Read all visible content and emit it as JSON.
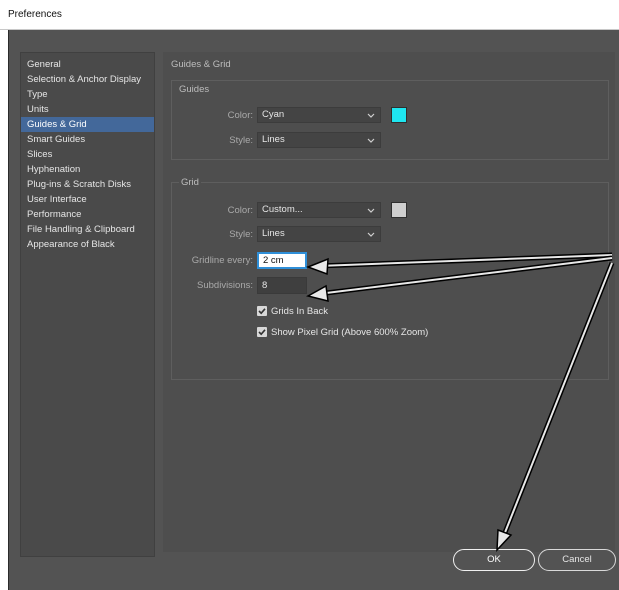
{
  "window": {
    "title": "Preferences"
  },
  "sidebar": {
    "items": [
      {
        "label": "General",
        "selected": false
      },
      {
        "label": "Selection & Anchor Display",
        "selected": false
      },
      {
        "label": "Type",
        "selected": false
      },
      {
        "label": "Units",
        "selected": false
      },
      {
        "label": "Guides & Grid",
        "selected": true
      },
      {
        "label": "Smart Guides",
        "selected": false
      },
      {
        "label": "Slices",
        "selected": false
      },
      {
        "label": "Hyphenation",
        "selected": false
      },
      {
        "label": "Plug-ins & Scratch Disks",
        "selected": false
      },
      {
        "label": "User Interface",
        "selected": false
      },
      {
        "label": "Performance",
        "selected": false
      },
      {
        "label": "File Handling & Clipboard",
        "selected": false
      },
      {
        "label": "Appearance of Black",
        "selected": false
      }
    ]
  },
  "main": {
    "section_title": "Guides & Grid",
    "guides": {
      "title": "Guides",
      "color_label": "Color:",
      "color_value": "Cyan",
      "swatch_color": "#1ee6f0",
      "style_label": "Style:",
      "style_value": "Lines"
    },
    "grid": {
      "title": "Grid",
      "color_label": "Color:",
      "color_value": "Custom...",
      "swatch_color": "#cfcfcf",
      "style_label": "Style:",
      "style_value": "Lines",
      "gridline_label": "Gridline every:",
      "gridline_value": "2 cm",
      "subdivisions_label": "Subdivisions:",
      "subdivisions_value": "8",
      "grids_in_back_label": "Grids In Back",
      "grids_in_back_checked": true,
      "pixel_grid_label": "Show Pixel Grid (Above 600% Zoom)",
      "pixel_grid_checked": true
    }
  },
  "buttons": {
    "ok": "OK",
    "cancel": "Cancel"
  },
  "colors": {
    "dialog_bg": "#535353",
    "selection": "#43689a",
    "focus_ring": "#2f8fd8"
  }
}
